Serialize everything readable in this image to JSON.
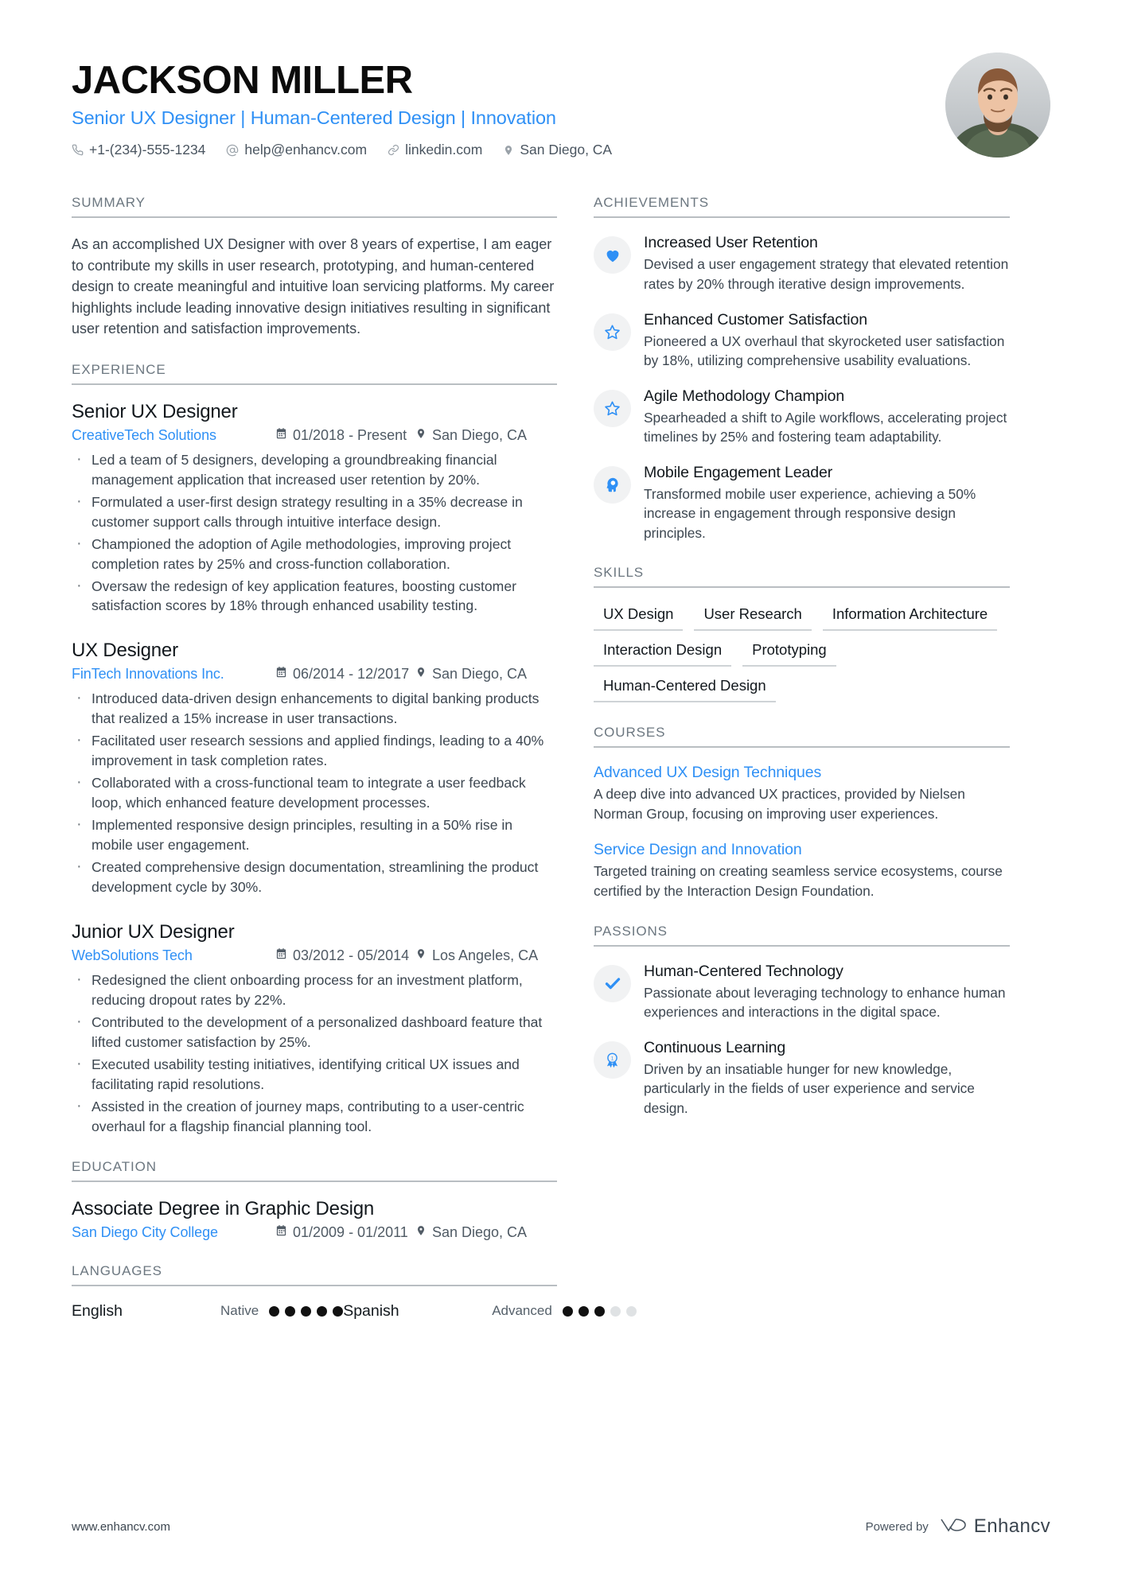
{
  "header": {
    "name": "JACKSON MILLER",
    "headline": "Senior UX Designer | Human-Centered Design | Innovation",
    "contacts": [
      {
        "icon": "phone-icon",
        "text": "+1-(234)-555-1234"
      },
      {
        "icon": "email-icon",
        "text": "help@enhancv.com"
      },
      {
        "icon": "link-icon",
        "text": "linkedin.com"
      },
      {
        "icon": "location-icon",
        "text": "San Diego, CA"
      }
    ],
    "accent_color": "#2f90f5"
  },
  "left": {
    "summary": {
      "title": "SUMMARY",
      "text": "As an accomplished UX Designer with over 8 years of expertise, I am eager to contribute my skills in user research, prototyping, and human-centered design to create meaningful and intuitive loan servicing platforms. My career highlights include leading innovative design initiatives resulting in significant user retention and satisfaction improvements."
    },
    "experience": {
      "title": "EXPERIENCE",
      "entries": [
        {
          "role": "Senior UX Designer",
          "org": "CreativeTech Solutions",
          "date": "01/2018 - Present",
          "location": "San Diego, CA",
          "bullets": [
            "Led a team of 5 designers, developing a groundbreaking financial management application that increased user retention by 20%.",
            "Formulated a user-first design strategy resulting in a 35% decrease in customer support calls through intuitive interface design.",
            "Championed the adoption of Agile methodologies, improving project completion rates by 25% and cross-function collaboration.",
            "Oversaw the redesign of key application features, boosting customer satisfaction scores by 18% through enhanced usability testing."
          ]
        },
        {
          "role": "UX Designer",
          "org": "FinTech Innovations Inc.",
          "date": "06/2014 - 12/2017",
          "location": "San Diego, CA",
          "bullets": [
            "Introduced data-driven design enhancements to digital banking products that realized a 15% increase in user transactions.",
            "Facilitated user research sessions and applied findings, leading to a 40% improvement in task completion rates.",
            "Collaborated with a cross-functional team to integrate a user feedback loop, which enhanced feature development processes.",
            "Implemented responsive design principles, resulting in a 50% rise in mobile user engagement.",
            "Created comprehensive design documentation, streamlining the product development cycle by 30%."
          ]
        },
        {
          "role": "Junior UX Designer",
          "org": "WebSolutions Tech",
          "date": "03/2012 - 05/2014",
          "location": "Los Angeles, CA",
          "bullets": [
            "Redesigned the client onboarding process for an investment platform, reducing dropout rates by 22%.",
            "Contributed to the development of a personalized dashboard feature that lifted customer satisfaction by 25%.",
            "Executed usability testing initiatives, identifying critical UX issues and facilitating rapid resolutions.",
            "Assisted in the creation of journey maps, contributing to a user-centric overhaul for a flagship financial planning tool."
          ]
        }
      ]
    },
    "education": {
      "title": "EDUCATION",
      "entries": [
        {
          "degree": "Associate Degree in Graphic Design",
          "school": "San Diego City College",
          "date": "01/2009 - 01/2011",
          "location": "San Diego, CA"
        }
      ]
    },
    "languages": {
      "title": "LANGUAGES",
      "items": [
        {
          "name": "English",
          "level": "Native",
          "filled": 5,
          "total": 5
        },
        {
          "name": "Spanish",
          "level": "Advanced",
          "filled": 3,
          "total": 5
        }
      ]
    }
  },
  "right": {
    "achievements": {
      "title": "ACHIEVEMENTS",
      "items": [
        {
          "icon": "heart-icon",
          "title": "Increased User Retention",
          "desc": "Devised a user engagement strategy that elevated retention rates by 20% through iterative design improvements."
        },
        {
          "icon": "star-icon",
          "title": "Enhanced Customer Satisfaction",
          "desc": "Pioneered a UX overhaul that skyrocketed user satisfaction by 18%, utilizing comprehensive usability evaluations."
        },
        {
          "icon": "star-icon",
          "title": "Agile Methodology Champion",
          "desc": "Spearheaded a shift to Agile workflows, accelerating project timelines by 25% and fostering team adaptability."
        },
        {
          "icon": "head-idea-icon",
          "title": "Mobile Engagement Leader",
          "desc": "Transformed mobile user experience, achieving a 50% increase in engagement through responsive design principles."
        }
      ]
    },
    "skills": {
      "title": "SKILLS",
      "items": [
        "UX Design",
        "User Research",
        "Information Architecture",
        "Interaction Design",
        "Prototyping",
        "Human-Centered Design"
      ]
    },
    "courses": {
      "title": "COURSES",
      "items": [
        {
          "name": "Advanced UX Design Techniques",
          "desc": "A deep dive into advanced UX practices, provided by Nielsen Norman Group, focusing on improving user experiences."
        },
        {
          "name": "Service Design and Innovation",
          "desc": "Targeted training on creating seamless service ecosystems, course certified by the Interaction Design Foundation."
        }
      ]
    },
    "passions": {
      "title": "PASSIONS",
      "items": [
        {
          "icon": "check-icon",
          "title": "Human-Centered Technology",
          "desc": "Passionate about leveraging technology to enhance human experiences and interactions in the digital space."
        },
        {
          "icon": "award-icon",
          "title": "Continuous Learning",
          "desc": "Driven by an insatiable hunger for new knowledge, particularly in the fields of user experience and service design."
        }
      ]
    }
  },
  "footer": {
    "url": "www.enhancv.com",
    "powered_by": "Powered by",
    "brand": "Enhancv"
  }
}
